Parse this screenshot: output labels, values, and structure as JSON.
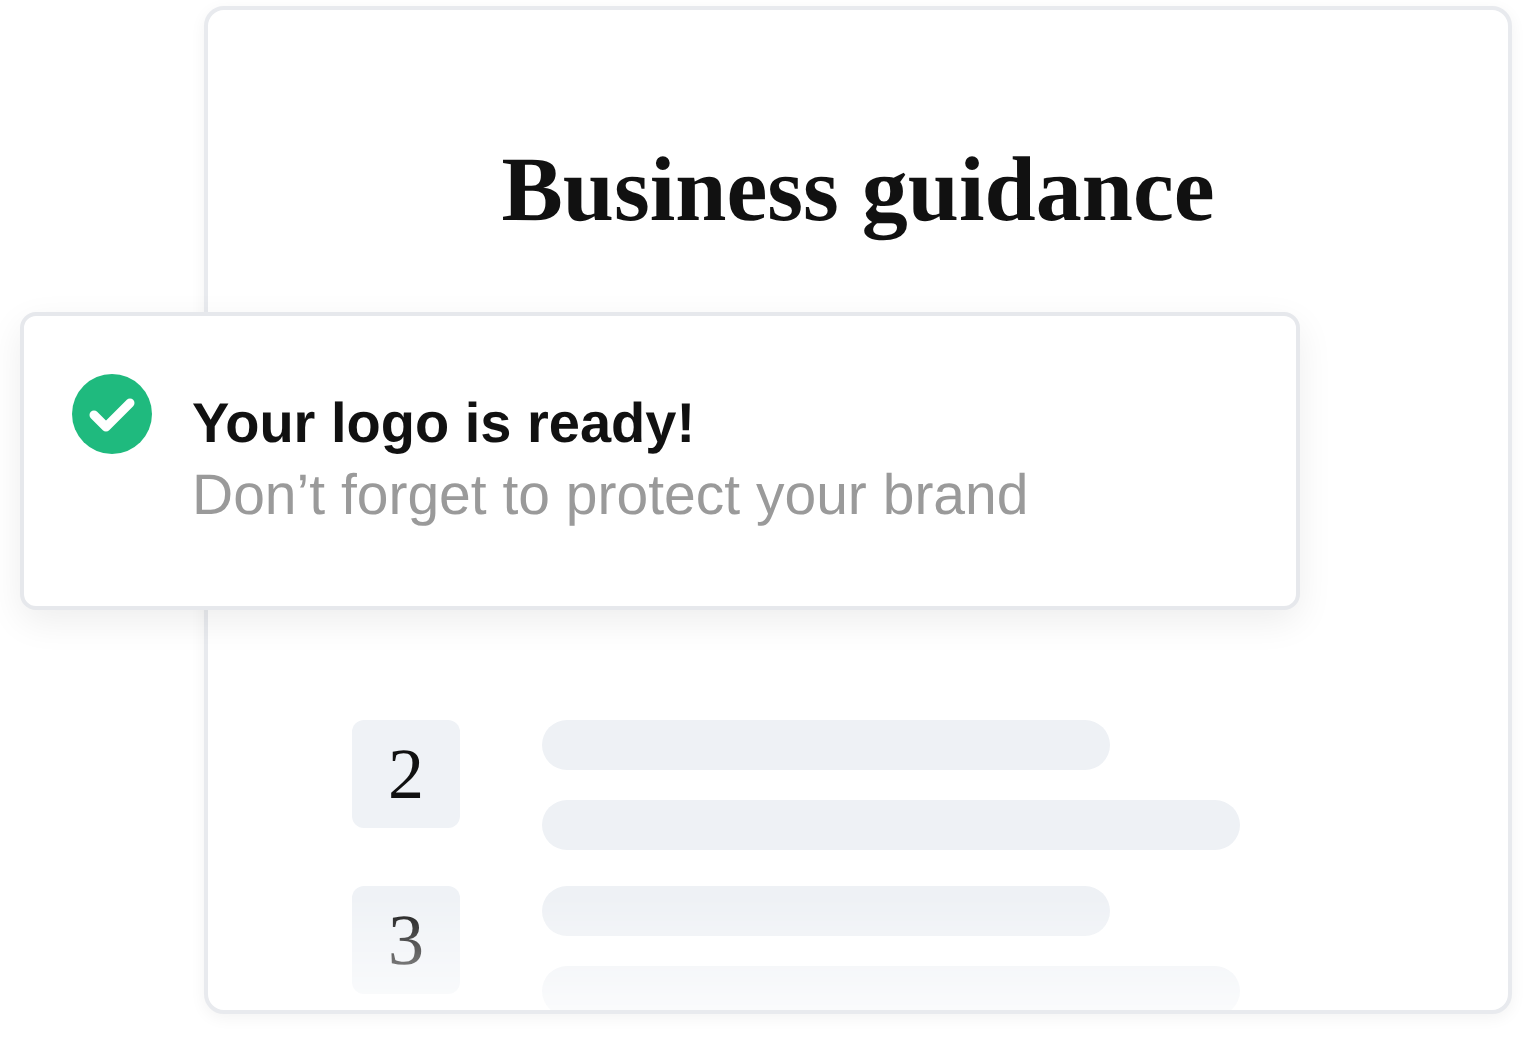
{
  "card": {
    "title": "Business guidance"
  },
  "toast": {
    "title": "Your logo is ready!",
    "message": "Don’t forget to protect your brand"
  },
  "steps": [
    {
      "number": "2"
    },
    {
      "number": "3"
    }
  ]
}
